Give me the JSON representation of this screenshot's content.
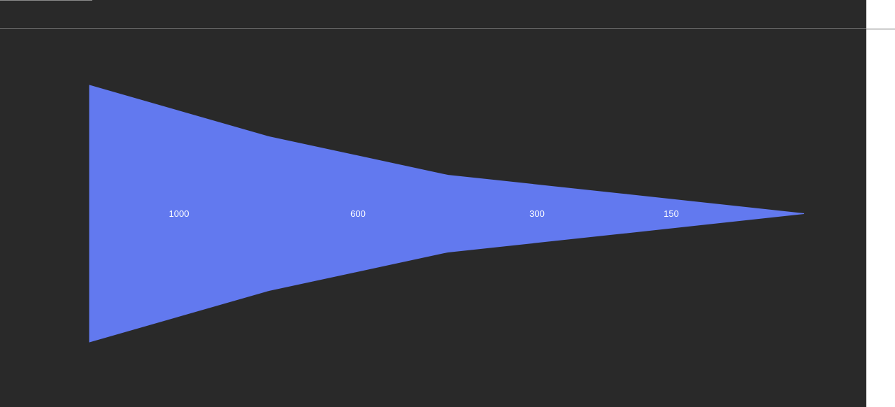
{
  "chart_data": {
    "type": "funnel",
    "orientation": "horizontal",
    "values": [
      1000,
      600,
      300,
      150
    ],
    "labels": [
      "1000",
      "600",
      "300",
      "150"
    ],
    "colors": {
      "fill": "#6279ef",
      "background": "#292929",
      "label": "#ffffff"
    }
  }
}
